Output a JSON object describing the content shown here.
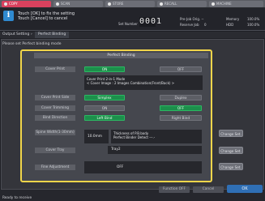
{
  "top_tabs": [
    {
      "label": "COPY",
      "active": true
    },
    {
      "label": "SCAN",
      "active": false
    },
    {
      "label": "STORE",
      "active": false
    },
    {
      "label": "RECALL",
      "active": false
    },
    {
      "label": "MACHINE",
      "active": false
    }
  ],
  "message": {
    "line1": "Touch [OK] to fix the setting",
    "line2": "Touch [Cancel] to cancel"
  },
  "set_number": {
    "label": "Set Number",
    "value": "0001"
  },
  "job_info": {
    "preregister_label": "Pre-Job Orig. --",
    "reserve_label": "Reserve Job",
    "reserve_value": "0",
    "memory_label": "Memory",
    "memory_value": "100.0%",
    "hdd_label": "HDD",
    "hdd_value": "100.0%"
  },
  "breadcrumb": {
    "parent": "Output Setting",
    "current": "Perfect Binding"
  },
  "prompt": "Please set Perfect binding mode",
  "dialog": {
    "title": "Perfect Binding",
    "cover_print": {
      "label": "Cover Print",
      "on": "ON",
      "off": "OFF",
      "info_line1": "Cover Print 2-in-1 Mode",
      "info_line2": "< Cover Image : 2 Images Combination(Front/Back) >"
    },
    "cover_print_side": {
      "label": "Cover Print Side",
      "simplex": "Simplex",
      "duplex": "Duplex"
    },
    "cover_trimming": {
      "label": "Cover Trimming",
      "on": "ON",
      "off": "OFF"
    },
    "bind_direction": {
      "label": "Bind Direction",
      "left": "Left Bind",
      "right": "Right Bind"
    },
    "spine_width": {
      "label": "Spine Width(1-30mm)",
      "value": "10.0mm",
      "info_line1": "Thickness of P.B.body",
      "info_line2": "Perfect Binder Detect  ---.-",
      "change": "Change Set."
    },
    "cover_tray": {
      "label": "Cover Tray",
      "value": "Tray2",
      "change": "Change Set."
    },
    "fine_adjustment": {
      "label": "Fine Adjustment",
      "value": "OFF",
      "change": "Change Set."
    }
  },
  "footer": {
    "function_off": "Function OFF",
    "cancel": "Cancel",
    "ok": "OK",
    "status": "Ready to receive"
  }
}
